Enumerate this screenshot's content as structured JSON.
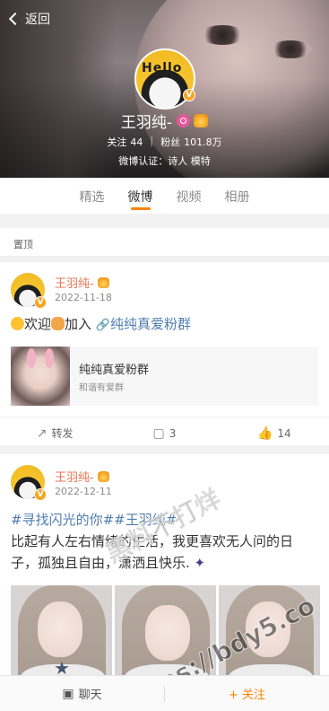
{
  "nav": {
    "back_label": "返回"
  },
  "profile": {
    "name": "王羽纯-",
    "following_label": "关注",
    "following_count": "44",
    "followers_label": "粉丝",
    "followers_count": "101.8万",
    "verification": "微博认证：诗人 模特",
    "avatar_text": "Hello"
  },
  "tabs": [
    {
      "label": "精选",
      "active": false
    },
    {
      "label": "微博",
      "active": true
    },
    {
      "label": "视频",
      "active": false
    },
    {
      "label": "相册",
      "active": false
    }
  ],
  "pinned_label": "置顶",
  "posts": [
    {
      "author": "王羽纯-",
      "date": "2022-11-18",
      "text_parts": [
        "欢迎",
        "加入",
        "纯纯真爱粉群"
      ],
      "embed": {
        "title": "纯纯真爱粉群",
        "subtitle": "和谐有爱群"
      },
      "repost_label": "转发",
      "comments": "3",
      "likes": "14"
    },
    {
      "author": "王羽纯-",
      "date": "2022-12-11",
      "hashtags": "#寻找闪光的你##王羽纯#",
      "text": "比起有人左右情绪的生活，我更喜欢无人问的日子，孤独且自由，潇洒且快乐.",
      "photo_count": 3
    }
  ],
  "bottom_bar": {
    "chat_label": "聊天",
    "follow_label": "+ 关注"
  },
  "watermark": {
    "line1": "黑料不打烊",
    "line2": "https://bdy5.co"
  },
  "colors": {
    "accent": "#ff8200",
    "username": "#eb7350",
    "link": "#507daf"
  },
  "icons": {
    "back": "chevron-left-icon",
    "repost": "repost-icon",
    "comment": "comment-icon",
    "like": "thumbs-up-icon",
    "chat": "chat-icon"
  }
}
